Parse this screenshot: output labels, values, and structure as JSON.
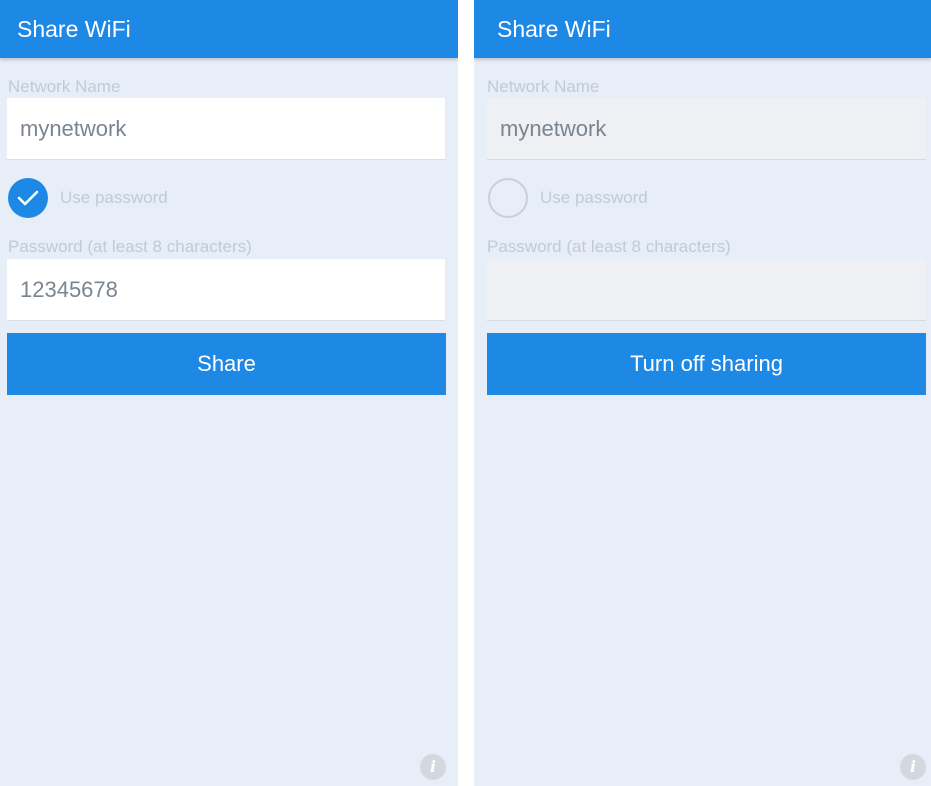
{
  "screens": [
    {
      "title": "Share WiFi",
      "network_label": "Network Name",
      "network_value": "mynetwork",
      "use_password_label": "Use password",
      "use_password_checked": true,
      "password_label": "Password (at least 8 characters)",
      "password_value": "12345678",
      "button_label": "Share",
      "info_icon": "info-icon"
    },
    {
      "title": "Share WiFi",
      "network_label": "Network Name",
      "network_value": "mynetwork",
      "use_password_label": "Use password",
      "use_password_checked": false,
      "password_label": "Password (at least 8 characters)",
      "password_value": "",
      "button_label": "Turn off sharing",
      "info_icon": "info-icon"
    }
  ],
  "colors": {
    "accent": "#1e88e5",
    "background": "#e8eef7",
    "label_text": "#c2cad4",
    "field_text": "#7a8590"
  }
}
